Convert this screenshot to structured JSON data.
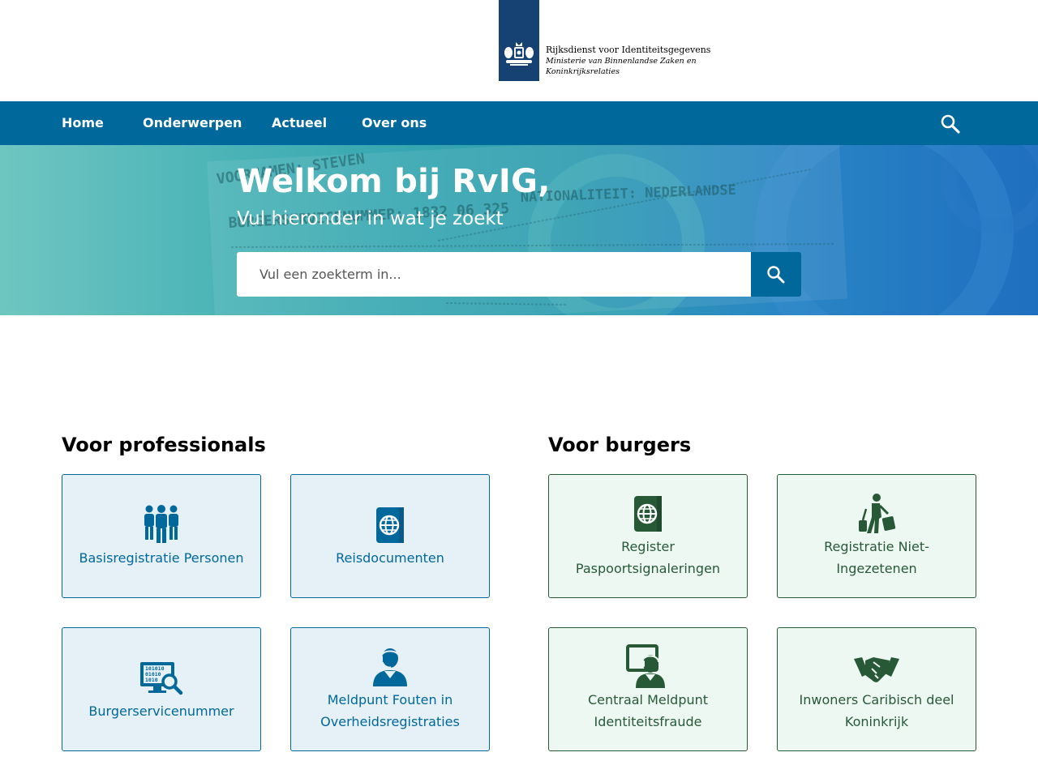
{
  "header": {
    "org_name": "Rijksdienst voor Identiteitsgegevens",
    "ministry_line1": "Ministerie van Binnenlandse Zaken en",
    "ministry_line2": "Koninkrijksrelaties",
    "brand_color": "#154273"
  },
  "nav": {
    "items": [
      {
        "label": "Home"
      },
      {
        "label": "Onderwerpen"
      },
      {
        "label": "Actueel"
      },
      {
        "label": "Over ons"
      }
    ],
    "search_icon": "search-icon",
    "color": "#01689b"
  },
  "hero": {
    "title": "Welkom bij RvIG,",
    "subtitle": "Vul hieronder in wat je zoekt",
    "search_placeholder": "Vul een zoekterm in...",
    "bg_text": {
      "line1": "VOORNAMEN: STEVEN",
      "line2": "BURGERSERVICENUMMER: 1832 06 325",
      "line3": "NATIONALITEIT: NEDERLANDSE"
    }
  },
  "professionals": {
    "title": "Voor professionals",
    "cards": [
      {
        "label": "Basisregistratie Personen",
        "icon": "people-group-icon"
      },
      {
        "label": "Reisdocumenten",
        "icon": "passport-icon"
      },
      {
        "label": "Burgerservicenummer",
        "icon": "monitor-search-icon"
      },
      {
        "label_line1": "Meldpunt Fouten in",
        "label_line2": "Overheidsregistraties",
        "icon": "support-agent-icon"
      }
    ],
    "color": "#01689b"
  },
  "citizens": {
    "title": "Voor burgers",
    "cards": [
      {
        "label_line1": "Register",
        "label_line2": "Paspoortsignaleringen",
        "icon": "passport-icon"
      },
      {
        "label_line1": "Registratie Niet-",
        "label_line2": "Ingezetenen",
        "icon": "traveler-luggage-icon"
      },
      {
        "label_line1": "Centraal Meldpunt",
        "label_line2": "Identiteitsfraude",
        "icon": "agent-screen-icon"
      },
      {
        "label_line1": "Inwoners Caribisch deel",
        "label_line2": "Koninkrijk",
        "icon": "handshake-icon"
      }
    ],
    "color": "#275937"
  }
}
